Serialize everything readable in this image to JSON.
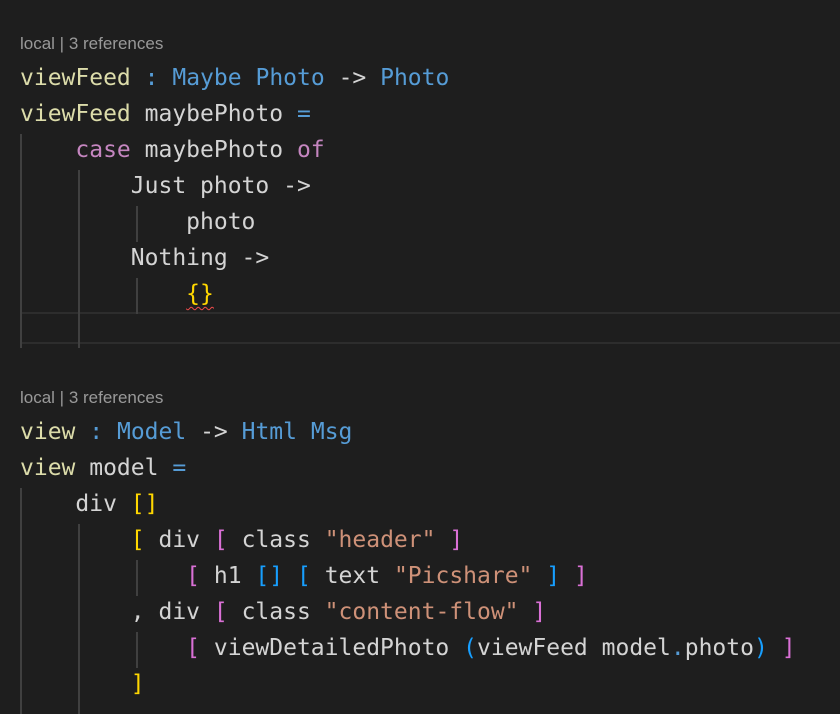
{
  "blocks": [
    {
      "codelens": "local | 3 references",
      "lines": [
        [
          [
            "fn",
            "viewFeed"
          ],
          [
            "op",
            " "
          ],
          [
            "eq",
            ":"
          ],
          [
            "op",
            " "
          ],
          [
            "ty",
            "Maybe"
          ],
          [
            "op",
            " "
          ],
          [
            "ty",
            "Photo"
          ],
          [
            "op",
            " -> "
          ],
          [
            "ty",
            "Photo"
          ]
        ],
        [
          [
            "fn",
            "viewFeed"
          ],
          [
            "tx",
            " maybePhoto "
          ],
          [
            "eq",
            "="
          ]
        ],
        [
          [
            "tx",
            "    "
          ],
          [
            "kw",
            "case"
          ],
          [
            "tx",
            " maybePhoto "
          ],
          [
            "kw",
            "of"
          ]
        ],
        [
          [
            "tx",
            "        Just photo ->"
          ]
        ],
        [
          [
            "tx",
            "            photo"
          ]
        ],
        [
          [
            "tx",
            "        Nothing ->"
          ]
        ],
        [
          [
            "tx",
            "            "
          ],
          [
            "b1 squig",
            "{}"
          ]
        ],
        [
          [
            "tx",
            ""
          ]
        ]
      ]
    },
    {
      "codelens": "local | 3 references",
      "lines": [
        [
          [
            "fn",
            "view"
          ],
          [
            "op",
            " "
          ],
          [
            "eq",
            ":"
          ],
          [
            "op",
            " "
          ],
          [
            "ty",
            "Model"
          ],
          [
            "op",
            " -> "
          ],
          [
            "ty",
            "Html"
          ],
          [
            "op",
            " "
          ],
          [
            "ty",
            "Msg"
          ]
        ],
        [
          [
            "fn",
            "view"
          ],
          [
            "tx",
            " model "
          ],
          [
            "eq",
            "="
          ]
        ],
        [
          [
            "tx",
            "    div "
          ],
          [
            "b1",
            "[]"
          ]
        ],
        [
          [
            "tx",
            "        "
          ],
          [
            "b1",
            "["
          ],
          [
            "tx",
            " div "
          ],
          [
            "b2",
            "["
          ],
          [
            "tx",
            " class "
          ],
          [
            "str",
            "\"header\""
          ],
          [
            "tx",
            " "
          ],
          [
            "b2",
            "]"
          ]
        ],
        [
          [
            "tx",
            "            "
          ],
          [
            "b2",
            "["
          ],
          [
            "tx",
            " h1 "
          ],
          [
            "b3",
            "[]"
          ],
          [
            "tx",
            " "
          ],
          [
            "b3",
            "["
          ],
          [
            "tx",
            " text "
          ],
          [
            "str",
            "\"Picshare\""
          ],
          [
            "tx",
            " "
          ],
          [
            "b3",
            "]"
          ],
          [
            "tx",
            " "
          ],
          [
            "b2",
            "]"
          ]
        ],
        [
          [
            "tx",
            "        , div "
          ],
          [
            "b2",
            "["
          ],
          [
            "tx",
            " class "
          ],
          [
            "str",
            "\"content-flow\""
          ],
          [
            "tx",
            " "
          ],
          [
            "b2",
            "]"
          ]
        ],
        [
          [
            "tx",
            "            "
          ],
          [
            "b2",
            "["
          ],
          [
            "tx",
            " viewDetailedPhoto "
          ],
          [
            "b3",
            "("
          ],
          [
            "tx",
            "viewFeed model"
          ],
          [
            "dot",
            "."
          ],
          [
            "tx",
            "photo"
          ],
          [
            "b3",
            ")"
          ],
          [
            "tx",
            " "
          ],
          [
            "b2",
            "]"
          ]
        ],
        [
          [
            "tx",
            "        "
          ],
          [
            "b1",
            "]"
          ]
        ]
      ]
    }
  ]
}
